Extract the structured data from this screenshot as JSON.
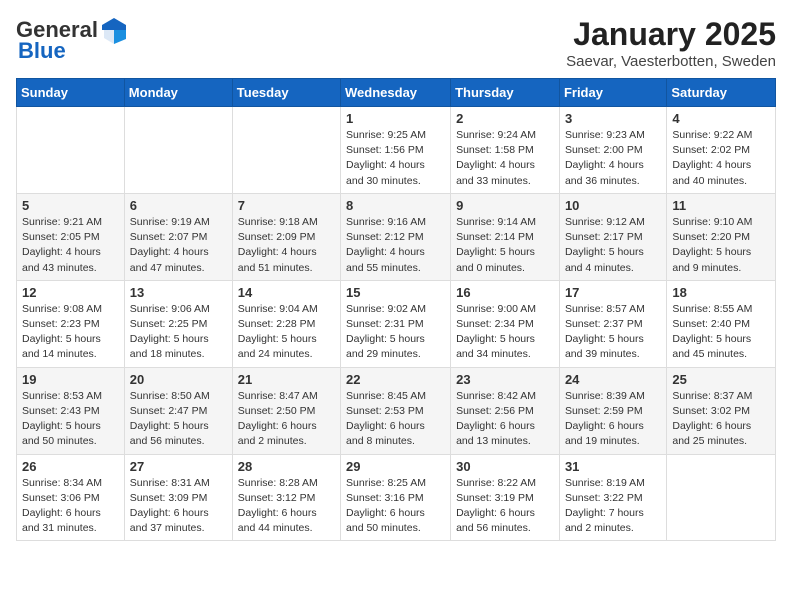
{
  "header": {
    "logo_general": "General",
    "logo_blue": "Blue",
    "title": "January 2025",
    "subtitle": "Saevar, Vaesterbotten, Sweden"
  },
  "days_of_week": [
    "Sunday",
    "Monday",
    "Tuesday",
    "Wednesday",
    "Thursday",
    "Friday",
    "Saturday"
  ],
  "weeks": [
    [
      {
        "day": "",
        "info": ""
      },
      {
        "day": "",
        "info": ""
      },
      {
        "day": "",
        "info": ""
      },
      {
        "day": "1",
        "info": "Sunrise: 9:25 AM\nSunset: 1:56 PM\nDaylight: 4 hours\nand 30 minutes."
      },
      {
        "day": "2",
        "info": "Sunrise: 9:24 AM\nSunset: 1:58 PM\nDaylight: 4 hours\nand 33 minutes."
      },
      {
        "day": "3",
        "info": "Sunrise: 9:23 AM\nSunset: 2:00 PM\nDaylight: 4 hours\nand 36 minutes."
      },
      {
        "day": "4",
        "info": "Sunrise: 9:22 AM\nSunset: 2:02 PM\nDaylight: 4 hours\nand 40 minutes."
      }
    ],
    [
      {
        "day": "5",
        "info": "Sunrise: 9:21 AM\nSunset: 2:05 PM\nDaylight: 4 hours\nand 43 minutes."
      },
      {
        "day": "6",
        "info": "Sunrise: 9:19 AM\nSunset: 2:07 PM\nDaylight: 4 hours\nand 47 minutes."
      },
      {
        "day": "7",
        "info": "Sunrise: 9:18 AM\nSunset: 2:09 PM\nDaylight: 4 hours\nand 51 minutes."
      },
      {
        "day": "8",
        "info": "Sunrise: 9:16 AM\nSunset: 2:12 PM\nDaylight: 4 hours\nand 55 minutes."
      },
      {
        "day": "9",
        "info": "Sunrise: 9:14 AM\nSunset: 2:14 PM\nDaylight: 5 hours\nand 0 minutes."
      },
      {
        "day": "10",
        "info": "Sunrise: 9:12 AM\nSunset: 2:17 PM\nDaylight: 5 hours\nand 4 minutes."
      },
      {
        "day": "11",
        "info": "Sunrise: 9:10 AM\nSunset: 2:20 PM\nDaylight: 5 hours\nand 9 minutes."
      }
    ],
    [
      {
        "day": "12",
        "info": "Sunrise: 9:08 AM\nSunset: 2:23 PM\nDaylight: 5 hours\nand 14 minutes."
      },
      {
        "day": "13",
        "info": "Sunrise: 9:06 AM\nSunset: 2:25 PM\nDaylight: 5 hours\nand 18 minutes."
      },
      {
        "day": "14",
        "info": "Sunrise: 9:04 AM\nSunset: 2:28 PM\nDaylight: 5 hours\nand 24 minutes."
      },
      {
        "day": "15",
        "info": "Sunrise: 9:02 AM\nSunset: 2:31 PM\nDaylight: 5 hours\nand 29 minutes."
      },
      {
        "day": "16",
        "info": "Sunrise: 9:00 AM\nSunset: 2:34 PM\nDaylight: 5 hours\nand 34 minutes."
      },
      {
        "day": "17",
        "info": "Sunrise: 8:57 AM\nSunset: 2:37 PM\nDaylight: 5 hours\nand 39 minutes."
      },
      {
        "day": "18",
        "info": "Sunrise: 8:55 AM\nSunset: 2:40 PM\nDaylight: 5 hours\nand 45 minutes."
      }
    ],
    [
      {
        "day": "19",
        "info": "Sunrise: 8:53 AM\nSunset: 2:43 PM\nDaylight: 5 hours\nand 50 minutes."
      },
      {
        "day": "20",
        "info": "Sunrise: 8:50 AM\nSunset: 2:47 PM\nDaylight: 5 hours\nand 56 minutes."
      },
      {
        "day": "21",
        "info": "Sunrise: 8:47 AM\nSunset: 2:50 PM\nDaylight: 6 hours\nand 2 minutes."
      },
      {
        "day": "22",
        "info": "Sunrise: 8:45 AM\nSunset: 2:53 PM\nDaylight: 6 hours\nand 8 minutes."
      },
      {
        "day": "23",
        "info": "Sunrise: 8:42 AM\nSunset: 2:56 PM\nDaylight: 6 hours\nand 13 minutes."
      },
      {
        "day": "24",
        "info": "Sunrise: 8:39 AM\nSunset: 2:59 PM\nDaylight: 6 hours\nand 19 minutes."
      },
      {
        "day": "25",
        "info": "Sunrise: 8:37 AM\nSunset: 3:02 PM\nDaylight: 6 hours\nand 25 minutes."
      }
    ],
    [
      {
        "day": "26",
        "info": "Sunrise: 8:34 AM\nSunset: 3:06 PM\nDaylight: 6 hours\nand 31 minutes."
      },
      {
        "day": "27",
        "info": "Sunrise: 8:31 AM\nSunset: 3:09 PM\nDaylight: 6 hours\nand 37 minutes."
      },
      {
        "day": "28",
        "info": "Sunrise: 8:28 AM\nSunset: 3:12 PM\nDaylight: 6 hours\nand 44 minutes."
      },
      {
        "day": "29",
        "info": "Sunrise: 8:25 AM\nSunset: 3:16 PM\nDaylight: 6 hours\nand 50 minutes."
      },
      {
        "day": "30",
        "info": "Sunrise: 8:22 AM\nSunset: 3:19 PM\nDaylight: 6 hours\nand 56 minutes."
      },
      {
        "day": "31",
        "info": "Sunrise: 8:19 AM\nSunset: 3:22 PM\nDaylight: 7 hours\nand 2 minutes."
      },
      {
        "day": "",
        "info": ""
      }
    ]
  ]
}
